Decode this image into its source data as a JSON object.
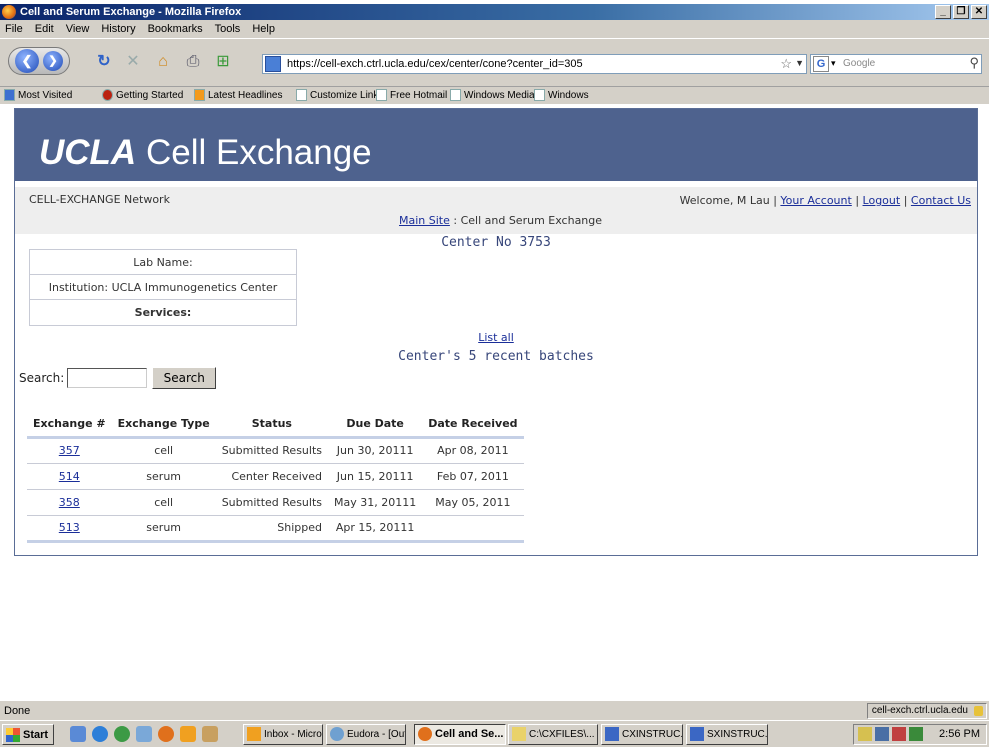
{
  "window": {
    "title": "Cell and Serum Exchange - Mozilla Firefox"
  },
  "menu": [
    "File",
    "Edit",
    "View",
    "History",
    "Bookmarks",
    "Tools",
    "Help"
  ],
  "nav": {
    "url": "https://cell-exch.ctrl.ucla.edu/cex/center/cone?center_id=305",
    "search_placeholder": "Google"
  },
  "bookmarks": [
    "Most Visited",
    "Getting Started",
    "Latest Headlines",
    "Customize Links",
    "Free Hotmail",
    "Windows Media",
    "Windows"
  ],
  "page": {
    "brand_bold": "UCLA",
    "brand_rest": "Cell Exchange",
    "network": "CELL-EXCHANGE Network",
    "welcome": "Welcome, M Lau |",
    "your_account": "Your Account",
    "logout": "Logout",
    "contact": "Contact Us",
    "sep": "|",
    "main_site": "Main Site",
    "crumb_rest": ": Cell and Serum Exchange",
    "center_no": "Center No 3753",
    "lab_name": "Lab Name:",
    "institution": "Institution: UCLA Immunogenetics Center",
    "services": "Services:",
    "list_all": "List all",
    "recent_title": "Center's 5 recent batches",
    "search_label": "Search:",
    "search_value": "",
    "search_button": "Search"
  },
  "table": {
    "headers": [
      "Exchange #",
      "Exchange Type",
      "Status",
      "Due Date",
      "Date Received"
    ],
    "rows": [
      {
        "id": "357",
        "type": "cell",
        "status": "Submitted Results",
        "due": "Jun 30, 20111",
        "received": "Apr 08, 2011"
      },
      {
        "id": "514",
        "type": "serum",
        "status": "Center Received",
        "due": "Jun 15, 20111",
        "received": "Feb 07, 2011"
      },
      {
        "id": "358",
        "type": "cell",
        "status": "Submitted Results",
        "due": "May 31, 20111",
        "received": "May 05, 2011"
      },
      {
        "id": "513",
        "type": "serum",
        "status": "Shipped",
        "due": "Apr 15, 20111",
        "received": ""
      }
    ]
  },
  "status": {
    "text": "Done",
    "domain": "cell-exch.ctrl.ucla.edu"
  },
  "taskbar": {
    "start": "Start",
    "tasks": [
      "Inbox - Micros...",
      "Eudora - [Out]",
      "Cell and Se...",
      "C:\\CXFILES\\...",
      "CXINSTRUC...",
      "SXINSTRUC..."
    ],
    "clock": "2:56 PM"
  }
}
